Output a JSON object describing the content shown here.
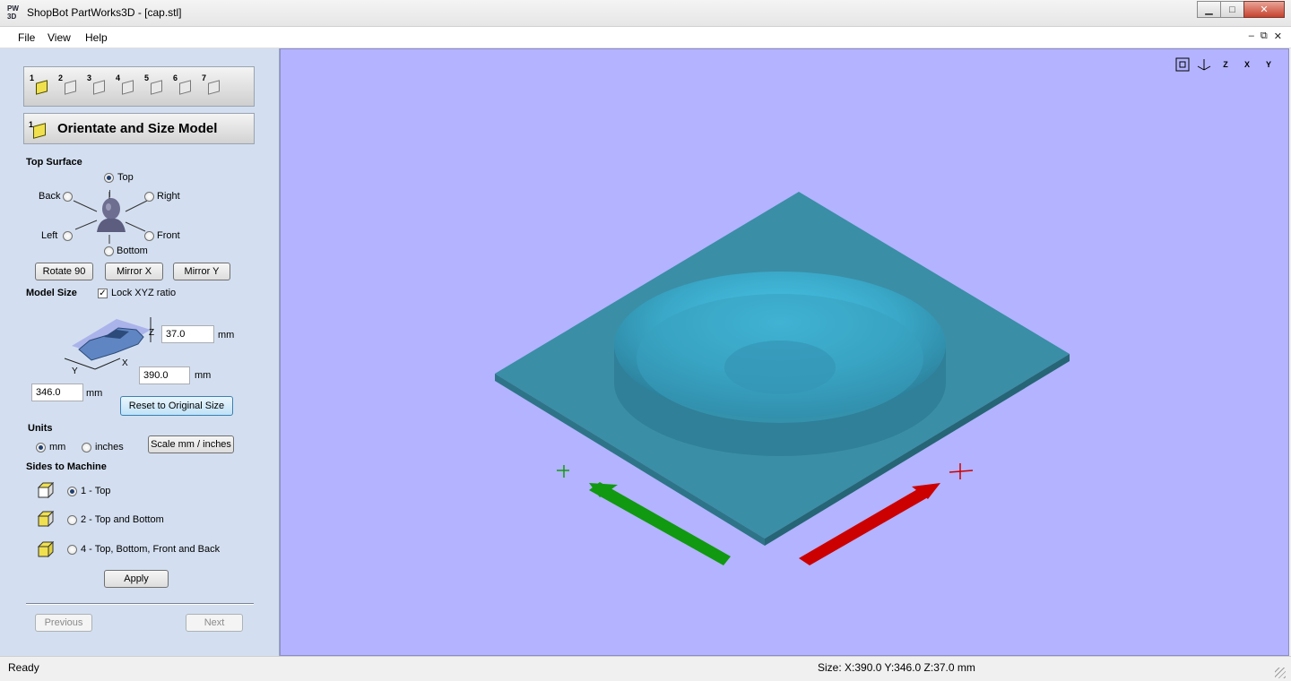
{
  "window": {
    "title": "ShopBot PartWorks3D - [cap.stl]",
    "icon_text": [
      "PW",
      "3D"
    ],
    "buttons": [
      "minimize",
      "maximize",
      "close"
    ]
  },
  "menu": {
    "items": [
      "File",
      "View",
      "Help"
    ],
    "mdi_controls": [
      "–",
      "⧉",
      "✕"
    ]
  },
  "wizard": {
    "steps": [
      "1",
      "2",
      "3",
      "4",
      "5",
      "6",
      "7"
    ],
    "active_step": 1,
    "step_title": "Orientate and Size Model",
    "step_number": "1"
  },
  "top_surface": {
    "label": "Top Surface",
    "options": {
      "top": "Top",
      "back": "Back",
      "right": "Right",
      "left": "Left",
      "front": "Front",
      "bottom": "Bottom"
    },
    "selected": "top",
    "buttons": {
      "rotate": "Rotate 90",
      "mirror_x": "Mirror X",
      "mirror_y": "Mirror Y"
    }
  },
  "model_size": {
    "label": "Model Size",
    "lock_label": "Lock XYZ ratio",
    "lock_checked": true,
    "axis_labels": {
      "z": "Z",
      "x": "X",
      "y": "Y"
    },
    "z_value": "37.0",
    "x_value": "390.0",
    "y_value": "346.0",
    "unit": "mm",
    "reset_button": "Reset to Original Size"
  },
  "units": {
    "label": "Units",
    "mm": "mm",
    "inches": "inches",
    "selected": "mm",
    "scale_button": "Scale mm / inches"
  },
  "sides": {
    "label": "Sides to Machine",
    "options": [
      "1 - Top",
      "2 - Top and Bottom",
      "4 - Top, Bottom, Front and Back"
    ],
    "selected_index": 0,
    "apply_button": "Apply"
  },
  "nav": {
    "previous": "Previous",
    "next": "Next"
  },
  "viewport": {
    "background": "#b3b3ff",
    "model_color": "#3aa8c8",
    "view_icons": [
      "fit-view-icon",
      "iso-view-icon",
      "z-view-icon",
      "x-view-icon",
      "y-view-icon"
    ],
    "view_icon_labels": [
      "",
      "",
      "Z",
      "X",
      "Y"
    ]
  },
  "status": {
    "left": "Ready",
    "right": "Size: X:390.0 Y:346.0 Z:37.0 mm"
  }
}
